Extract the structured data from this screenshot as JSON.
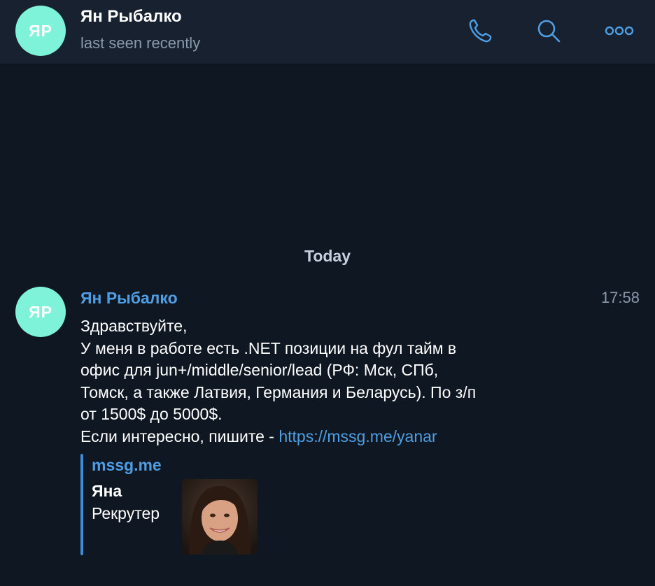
{
  "header": {
    "avatar_initials": "ЯР",
    "avatar_color": "#7ff3d9",
    "name": "Ян Рыбалко",
    "status": "last seen recently",
    "actions": [
      "phone-icon",
      "search-icon",
      "more-icon"
    ]
  },
  "date_separator": "Today",
  "message": {
    "avatar_initials": "ЯР",
    "sender": "Ян Рыбалко",
    "time": "17:58",
    "lines": [
      "Здравствуйте,",
      "У меня в работе есть .NET позиции на фул тайм в",
      "офис для jun+/middle/senior/lead (РФ: Мск, СПб,",
      "Томск, а также Латвия, Германия и Беларусь). По з/п",
      "от 1500$ до 5000$."
    ],
    "last_line_prefix": "Если интересно, пишите - ",
    "link": "https://mssg.me/yanar",
    "preview": {
      "site": "mssg.me",
      "title": "Яна",
      "description": "Рекрутер"
    }
  },
  "colors": {
    "background": "#0f1722",
    "header_bg": "#17212f",
    "accent": "#4f9ee3",
    "muted": "#8a99ab"
  }
}
